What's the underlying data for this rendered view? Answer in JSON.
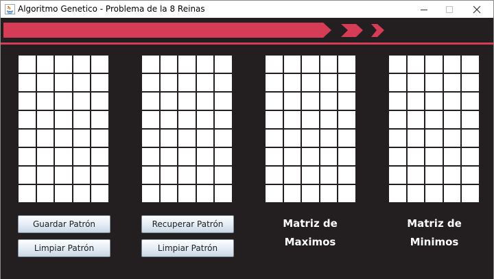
{
  "window": {
    "title": "Algoritmo Genetico - Problema de la 8 Reinas",
    "app_icon": "java-icon",
    "controls": [
      "minimize-icon",
      "maximize-icon",
      "close-icon"
    ]
  },
  "colors": {
    "background": "#231f20",
    "accent": "#d63c56",
    "cell": "#ffffff"
  },
  "grid": {
    "rows": 8,
    "cols": 5
  },
  "buttons": {
    "guardar": "Guardar Patrón",
    "limpiar_1": "Limpiar Patrón",
    "recuperar": "Recuperar Patrón",
    "limpiar_2": "Limpiar Patrón"
  },
  "captions": {
    "maximos_line1": "Matriz de",
    "maximos_line2": "Maximos",
    "minimos_line1": "Matriz de",
    "minimos_line2": "Minimos"
  }
}
